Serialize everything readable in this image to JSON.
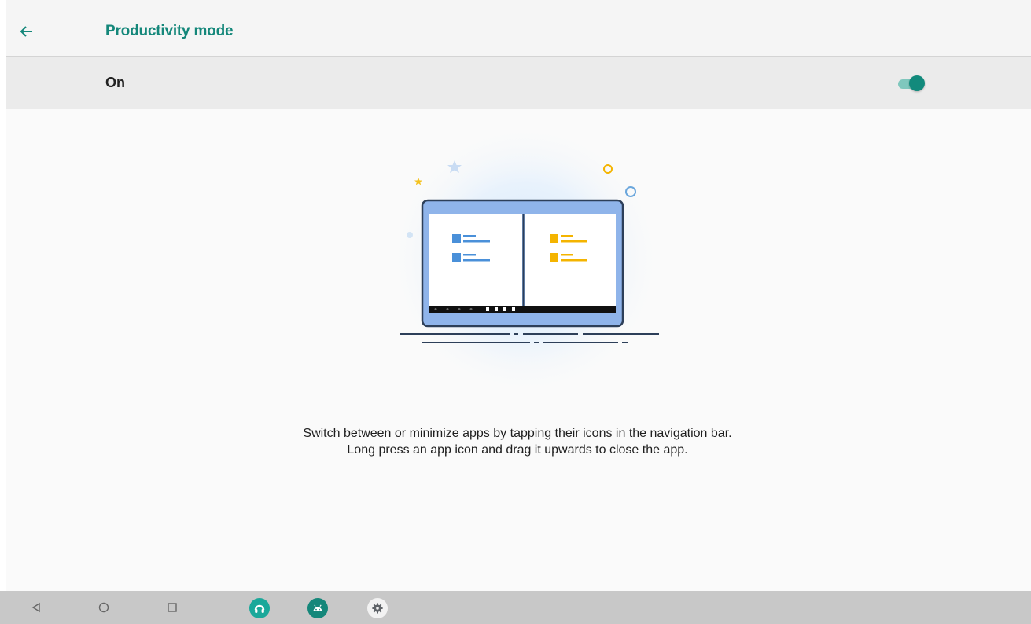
{
  "header": {
    "title": "Productivity mode",
    "back_icon": "arrow-left-icon"
  },
  "toggle": {
    "label": "On",
    "state": "on",
    "accent": "#128a7c",
    "track": "#7fc7bd"
  },
  "illustration": {
    "left_icon_color": "#4a90d9",
    "right_icon_color": "#f4b400"
  },
  "description": {
    "line1": "Switch between or minimize apps by tapping their icons in the navigation bar.",
    "line2": "Long press an app icon and drag it upwards to close the app."
  },
  "navbar": {
    "buttons": [
      "back-triangle-icon",
      "home-circle-icon",
      "recents-square-icon"
    ],
    "apps": [
      {
        "icon": "headset-app-icon",
        "color": "#1aa89a"
      },
      {
        "icon": "android-app-icon",
        "color": "#15877a"
      },
      {
        "icon": "settings-gear-icon",
        "color": "#f2f2f2"
      }
    ]
  }
}
